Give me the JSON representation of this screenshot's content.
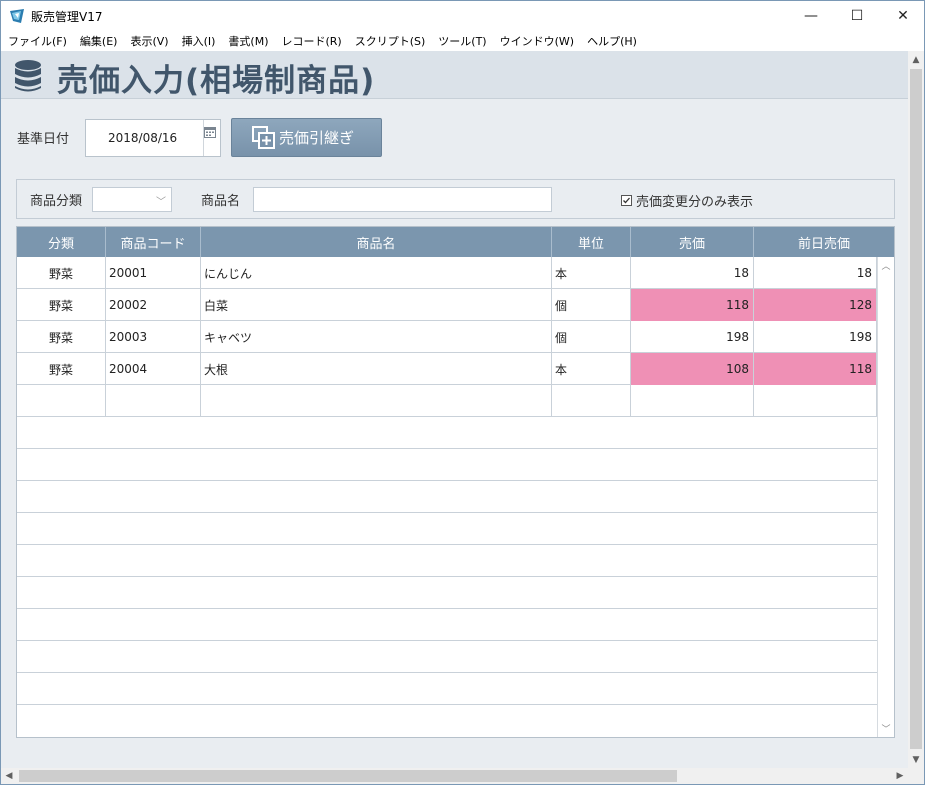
{
  "window": {
    "title": "販売管理V17",
    "minimize_glyph": "—",
    "maximize_glyph": "☐",
    "close_glyph": "✕"
  },
  "menu": [
    "ファイル(F)",
    "編集(E)",
    "表示(V)",
    "挿入(I)",
    "書式(M)",
    "レコード(R)",
    "スクリプト(S)",
    "ツール(T)",
    "ウインドウ(W)",
    "ヘルプ(H)"
  ],
  "page": {
    "title": "売価入力(相場制商品)",
    "icon": "database-icon"
  },
  "toolbar": {
    "base_date_label": "基準日付",
    "base_date_value": "2018/08/16",
    "carry_button_label": "売価引継ぎ"
  },
  "filter": {
    "category_label": "商品分類",
    "category_value": "",
    "name_label": "商品名",
    "name_value": "",
    "changed_only_label": "売価変更分のみ表示",
    "changed_only_checked": true
  },
  "grid": {
    "columns": [
      "分類",
      "商品コード",
      "商品名",
      "単位",
      "売価",
      "前日売価"
    ],
    "rows": [
      {
        "category": "野菜",
        "code": "20001",
        "name": "にんじん",
        "unit": "本",
        "price": "18",
        "prev_price": "18",
        "changed": false
      },
      {
        "category": "野菜",
        "code": "20002",
        "name": "白菜",
        "unit": "個",
        "price": "118",
        "prev_price": "128",
        "changed": true
      },
      {
        "category": "野菜",
        "code": "20003",
        "name": "キャベツ",
        "unit": "個",
        "price": "198",
        "prev_price": "198",
        "changed": false
      },
      {
        "category": "野菜",
        "code": "20004",
        "name": "大根",
        "unit": "本",
        "price": "108",
        "prev_price": "118",
        "changed": true
      }
    ],
    "highlight_color": "#ef90b5"
  },
  "colors": {
    "header_band": "#dbe2e9",
    "title_text": "#41566b",
    "grid_header": "#7b96ae",
    "button": "#7892aa"
  }
}
